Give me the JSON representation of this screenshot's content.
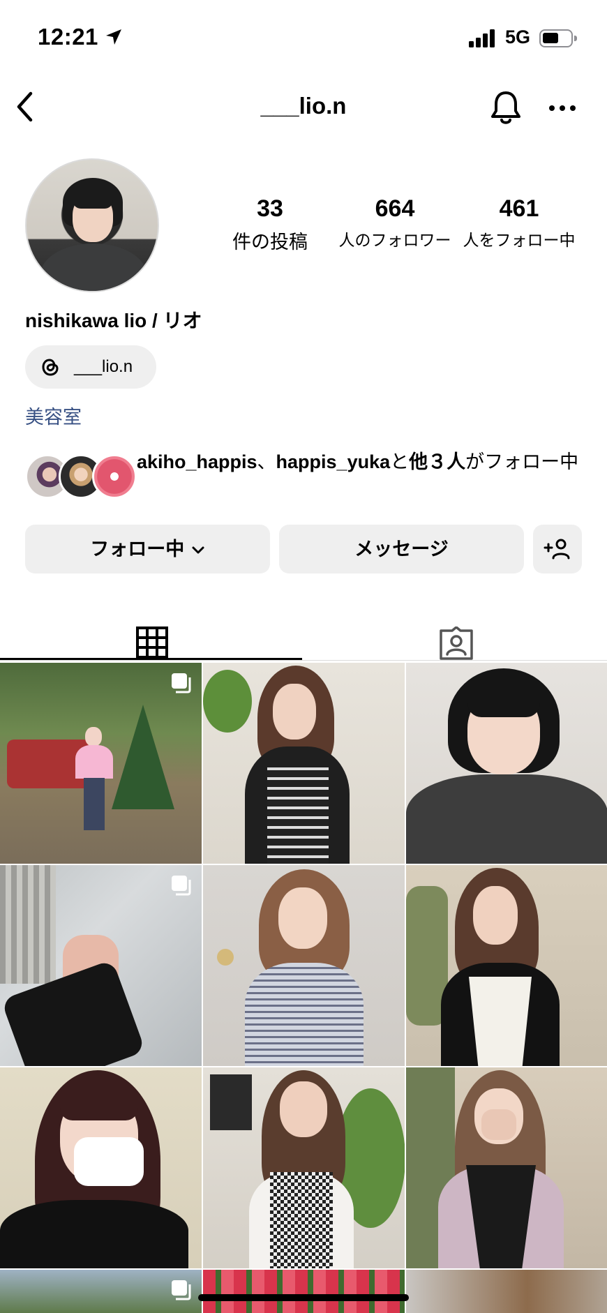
{
  "status_bar": {
    "time": "12:21",
    "network": "5G"
  },
  "header": {
    "username": "___lio.n"
  },
  "profile": {
    "full_name": "nishikawa lio / リオ",
    "stats": [
      {
        "value": "33",
        "label": "件の投稿"
      },
      {
        "value": "664",
        "label": "人のフォロワー"
      },
      {
        "value": "461",
        "label": "人をフォロー中"
      }
    ],
    "threads_label": "___lio.n",
    "category": "美容室"
  },
  "mutual": {
    "user1": "akiho_happis",
    "sep": "、",
    "user2": "happis_yuka",
    "mid": "と",
    "others": "他３人",
    "suffix": "がフォロー中"
  },
  "buttons": {
    "follow": "フォロー中",
    "message": "メッセージ"
  },
  "colors": {
    "category": "#385184",
    "button_bg": "#efefef",
    "divider": "#dbdbdb"
  },
  "icons": [
    "location-arrow-icon",
    "signal-icon",
    "battery-icon",
    "back-chevron-icon",
    "bell-icon",
    "more-icon",
    "threads-icon",
    "chevron-down-icon",
    "add-person-icon",
    "grid-icon",
    "tagged-icon",
    "multiple-posts-icon"
  ]
}
